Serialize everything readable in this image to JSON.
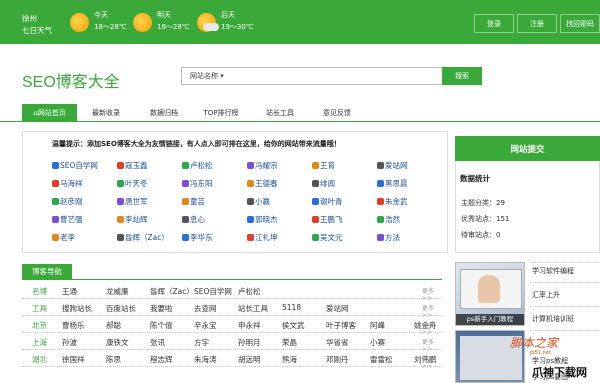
{
  "header": {
    "city": "徐州",
    "forecast_label": "七日天气",
    "days": [
      {
        "day": "今天",
        "temp": "18～28℃",
        "icon": "sun-icon"
      },
      {
        "day": "明天",
        "temp": "18～28℃",
        "icon": "sun-icon"
      },
      {
        "day": "后天",
        "temp": "19～30℃",
        "icon": "sun-cloud-icon"
      }
    ],
    "buttons": [
      "登录",
      "注册",
      "找回密码"
    ]
  },
  "logo": "SEO博客大全",
  "search": {
    "scope": "网站名称",
    "button": "搜索"
  },
  "nav": [
    "网站首页",
    "最新收录",
    "数据归档",
    "TOP排行榜",
    "站长工具",
    "意见反馈"
  ],
  "notice": "温馨提示：添加SEO博客大全为友情链接，有人点入即可排在这里，给你的网站带来流量哦！",
  "links": [
    [
      "SEO自学网",
      "寇玉鑫",
      "卢松松",
      "冯耀宗",
      "王育",
      "爱站网"
    ],
    [
      "马海祥",
      "叶天冬",
      "冯东阳",
      "王德春",
      "绯闻",
      "黑思晨"
    ],
    [
      "赵彦刚",
      "唐世军",
      "童芸",
      "小嬴",
      "谢叶青",
      "朱金武"
    ],
    [
      "曹艺强",
      "李灿辉",
      "息心",
      "郭晓杰",
      "王鹏飞",
      "浩然"
    ],
    [
      "老李",
      "昝辉（Zac）",
      "李华东",
      "江礼坤",
      "吴文元",
      "方法"
    ]
  ],
  "right_panel": {
    "submit_label": "网站提交",
    "stats_title": "数据统计",
    "stats": [
      "主题分类：29",
      "优秀站点：151",
      "待审站点：0"
    ]
  },
  "blog_nav": {
    "label": "博客导航",
    "rows": [
      {
        "cat": "名博",
        "items": [
          "王通",
          "龙威廉",
          "昝辉（Zac）",
          "SEO自学网",
          "卢松松"
        ]
      },
      {
        "cat": "工具",
        "items": [
          "搜狗站长",
          "百度站长",
          "我要啦",
          "去查网",
          "站长工具",
          "5118",
          "爱站网"
        ]
      },
      {
        "cat": "北京",
        "items": [
          "曹杨乐",
          "郝聪",
          "陈个僖",
          "辛永宝",
          "申永祥",
          "侯文武",
          "叶子博客",
          "阿峰",
          "姚金舟"
        ]
      },
      {
        "cat": "上海",
        "items": [
          "孙波",
          "康铁文",
          "张讯",
          "方宇",
          "孙明月",
          "荣晶",
          "华省省",
          "小赛"
        ]
      },
      {
        "cat": "湖北",
        "items": [
          "徐国祥",
          "陈思",
          "程志辉",
          "朱海涛",
          "胡远明",
          "熊海",
          "邓刚丹",
          "雷雷松",
          "刘伟鹏"
        ]
      }
    ],
    "more": "更多>>"
  },
  "thumbs": [
    {
      "caption": "ps新手入门教程"
    },
    {
      "caption": ""
    }
  ],
  "right_links": [
    "学习软件编程",
    "汇率上升",
    "计算机培训班",
    "学习ps教程",
    "学习ps要图"
  ],
  "watermark": {
    "top": "脚本之家",
    "sub": "jb51.net",
    "bottom": "爪神下载网"
  }
}
